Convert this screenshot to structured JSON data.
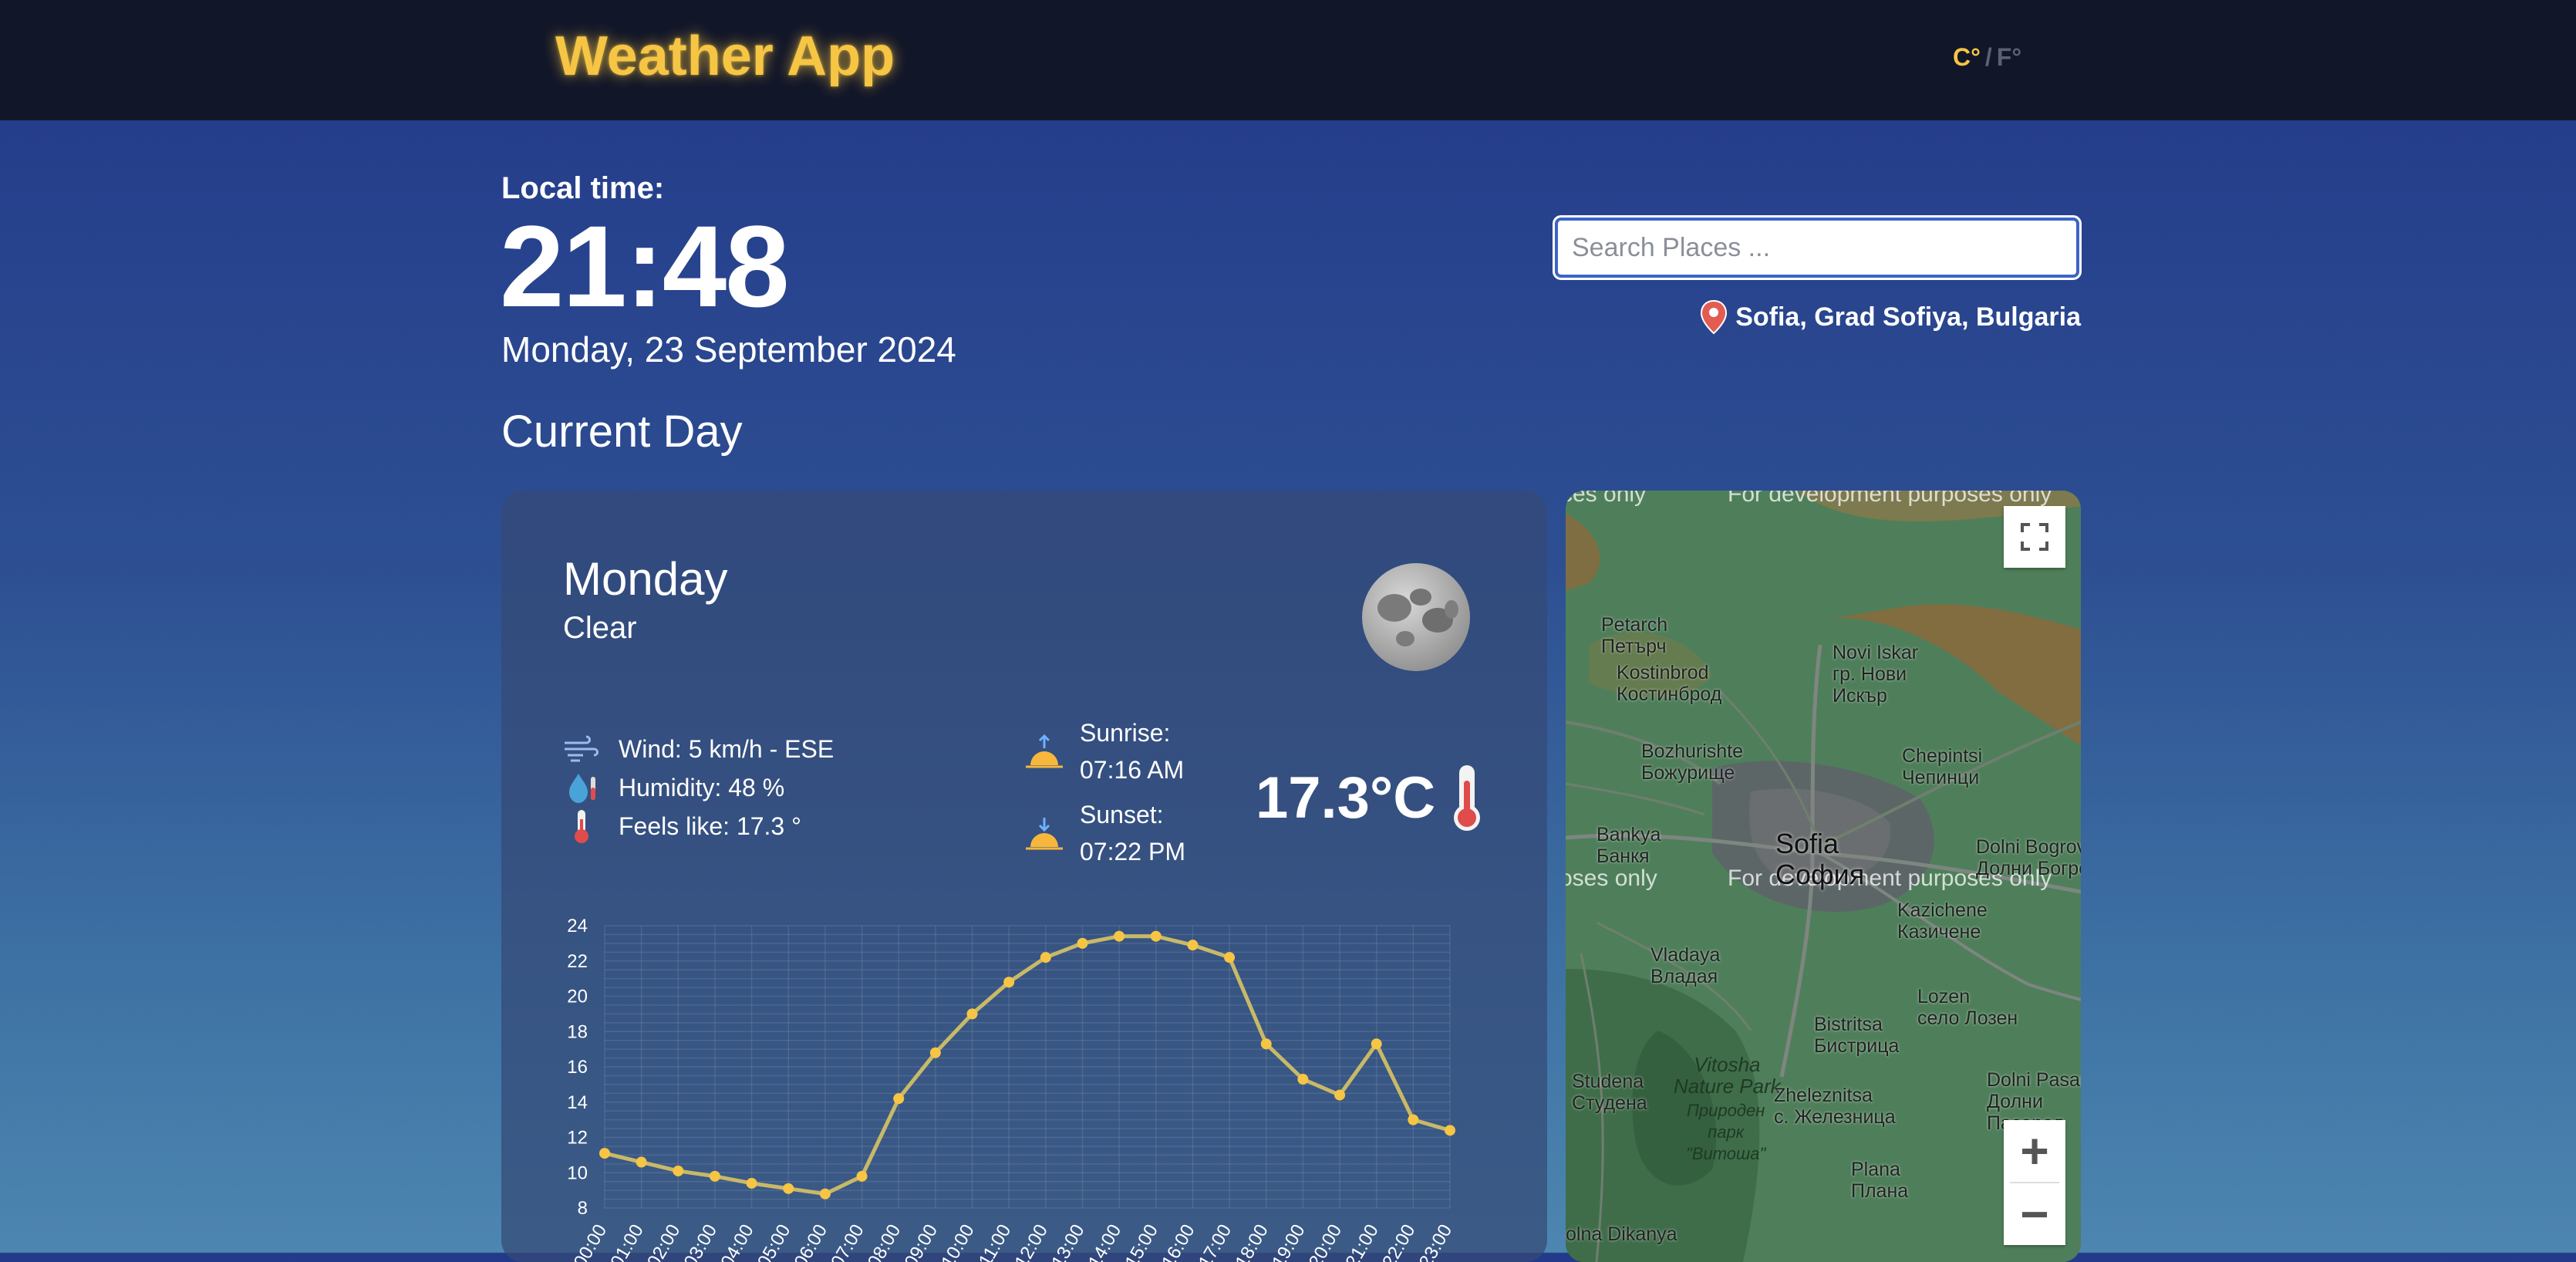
{
  "header": {
    "brand": "Weather App",
    "unit_c": "C°",
    "unit_sep": "/",
    "unit_f": "F°"
  },
  "time_panel": {
    "label": "Local time:",
    "time": "21:48",
    "date": "Monday, 23 September 2024"
  },
  "search": {
    "placeholder": "Search Places ...",
    "value": ""
  },
  "location": "Sofia, Grad Sofiya, Bulgaria",
  "section_title": "Current Day",
  "day": {
    "name": "Monday",
    "condition": "Clear",
    "condition_icon": "moon-icon",
    "wind": "Wind: 5 km/h - ESE",
    "humidity": "Humidity: 48 %",
    "feels_like": "Feels like: 17.3 °",
    "sunrise_label": "Sunrise:",
    "sunrise": "07:16 AM",
    "sunset_label": "Sunset:",
    "sunset": "07:22 PM",
    "temperature": "17.3°C"
  },
  "chart_data": {
    "type": "line",
    "categories": [
      "00:00",
      "01:00",
      "02:00",
      "03:00",
      "04:00",
      "05:00",
      "06:00",
      "07:00",
      "08:00",
      "09:00",
      "10:00",
      "11:00",
      "12:00",
      "13:00",
      "14:00",
      "15:00",
      "16:00",
      "17:00",
      "18:00",
      "19:00",
      "20:00",
      "21:00",
      "22:00",
      "23:00"
    ],
    "values": [
      11.1,
      10.6,
      10.1,
      9.8,
      9.4,
      9.1,
      8.8,
      9.8,
      14.2,
      16.8,
      19.0,
      20.8,
      22.2,
      23.0,
      23.4,
      23.4,
      22.9,
      22.2,
      17.3,
      15.3,
      14.4,
      17.3,
      13.0,
      12.4
    ],
    "ylim": [
      8,
      24
    ],
    "yticks": [
      8,
      10,
      12,
      14,
      16,
      18,
      20,
      22,
      24
    ],
    "grid": true,
    "line_color": "#c8b968",
    "point_color": "#f6c544"
  },
  "map": {
    "labels": [
      {
        "text": "Petarch\nПетърч",
        "cls": "map-label"
      },
      {
        "text": "Kostinbrod\nКостинброд",
        "cls": "map-label"
      },
      {
        "text": "Novi Iskar\nгр. Нови\nИскър",
        "cls": "map-label"
      },
      {
        "text": "Bozhurishte\nБожурище",
        "cls": "map-label"
      },
      {
        "text": "Chepintsi\nЧепинци",
        "cls": "map-label"
      },
      {
        "text": "Bankya\nБанкя",
        "cls": "map-label"
      },
      {
        "text": "Sofia\nСофия",
        "cls": "map-city"
      },
      {
        "text": "Dolni Bogrov\nДолни Богров",
        "cls": "map-label"
      },
      {
        "text": "Kazichene\nКазичене",
        "cls": "map-label"
      },
      {
        "text": "Vladaya\nВладая",
        "cls": "map-label"
      },
      {
        "text": "Lozen\nсело Лозен",
        "cls": "map-label"
      },
      {
        "text": "Bistritsa\nБистрица",
        "cls": "map-label"
      },
      {
        "text": "Vitosha\nNature Park",
        "cls": "park"
      },
      {
        "text": "Природен\nпарк\n\"Витоша\"",
        "cls": "park"
      },
      {
        "text": "Studena\nСтудена",
        "cls": "map-label"
      },
      {
        "text": "Zheleznitsa\nс. Железница",
        "cls": "map-label"
      },
      {
        "text": "Dolni Pasarel\nДолни\nПасарел",
        "cls": "map-label"
      },
      {
        "text": "Plana\nПлана",
        "cls": "map-label"
      },
      {
        "text": "olna Dikanya",
        "cls": "map-label"
      }
    ],
    "dev_notice": "For development purposes only",
    "dev_notice_left": "oses only",
    "dev_notice_top_left": "ces only",
    "zoom_in": "+",
    "zoom_out": "−"
  }
}
